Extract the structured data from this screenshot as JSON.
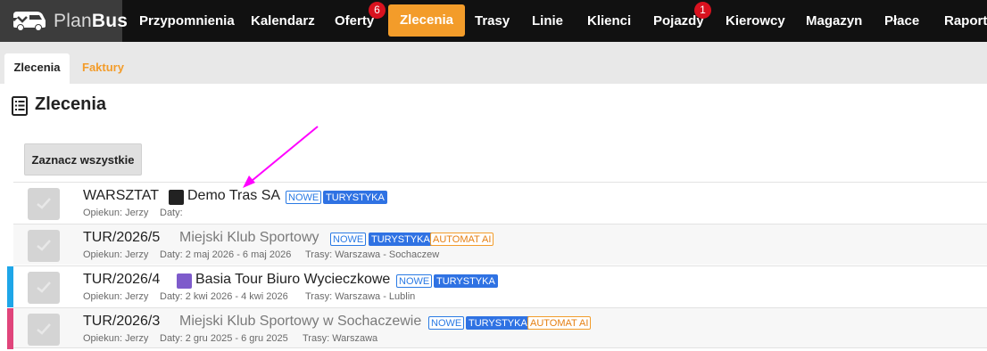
{
  "brand": {
    "plan": "Plan",
    "bus": "Bus"
  },
  "nav": [
    {
      "label": "Przypomnienia"
    },
    {
      "label": "Kalendarz"
    },
    {
      "label": "Oferty",
      "badge": "6"
    },
    {
      "label": "Zlecenia",
      "active": true
    },
    {
      "label": "Trasy"
    },
    {
      "label": "Linie"
    },
    {
      "label": "Klienci"
    },
    {
      "label": "Pojazdy",
      "badge": "1"
    },
    {
      "label": "Kierowcy"
    },
    {
      "label": "Magazyn"
    },
    {
      "label": "Płace"
    },
    {
      "label": "Raporty"
    }
  ],
  "tabs": {
    "active": "Zlecenia",
    "other": "Faktury"
  },
  "page_title": "Zlecenia",
  "select_all_label": "Zaznacz wszystkie",
  "rows": [
    {
      "number": "WARSZTAT",
      "client": "Demo Tras SA",
      "swatch_color": "#222222",
      "tags": [
        "NOWE",
        "TURYSTYKA"
      ],
      "opiekun": "Opiekun: Jerzy",
      "daty": "Daty:",
      "trasy": ""
    },
    {
      "number": "TUR/2026/5",
      "client": "Miejski Klub Sportowy",
      "tags": [
        "NOWE",
        "TURYSTYKA",
        "AUTOMAT AI"
      ],
      "opiekun": "Opiekun: Jerzy",
      "daty": "Daty: 2 maj 2026 - 6 maj 2026",
      "trasy": "Trasy: Warszawa - Sochaczew"
    },
    {
      "number": "TUR/2026/4",
      "client": "Basia Tour Biuro Wycieczkowe",
      "swatch_color": "#7e5bcb",
      "stripe_color": "#1ea6e8",
      "tags": [
        "NOWE",
        "TURYSTYKA"
      ],
      "opiekun": "Opiekun: Jerzy",
      "daty": "Daty: 2 kwi 2026 - 4 kwi 2026",
      "trasy": "Trasy: Warszawa - Lublin"
    },
    {
      "number": "TUR/2026/3",
      "client": "Miejski Klub Sportowy w Sochaczewie",
      "stripe_color": "#e0457b",
      "tags": [
        "NOWE",
        "TURYSTYKA",
        "AUTOMAT AI"
      ],
      "opiekun": "Opiekun: Jerzy",
      "daty": "Daty: 2 gru 2025 - 6 gru 2025",
      "trasy": "Trasy: Warszawa"
    }
  ],
  "colors": {
    "accent": "#f39c2a",
    "badge": "#d9121f",
    "tag_blue": "#2f72e3",
    "annotation_arrow": "#ff00ff"
  },
  "icons": {
    "logo": "bus-icon",
    "title": "document-list-icon",
    "checkbox": "checkmark-icon",
    "annotation": "arrow-annotation"
  }
}
